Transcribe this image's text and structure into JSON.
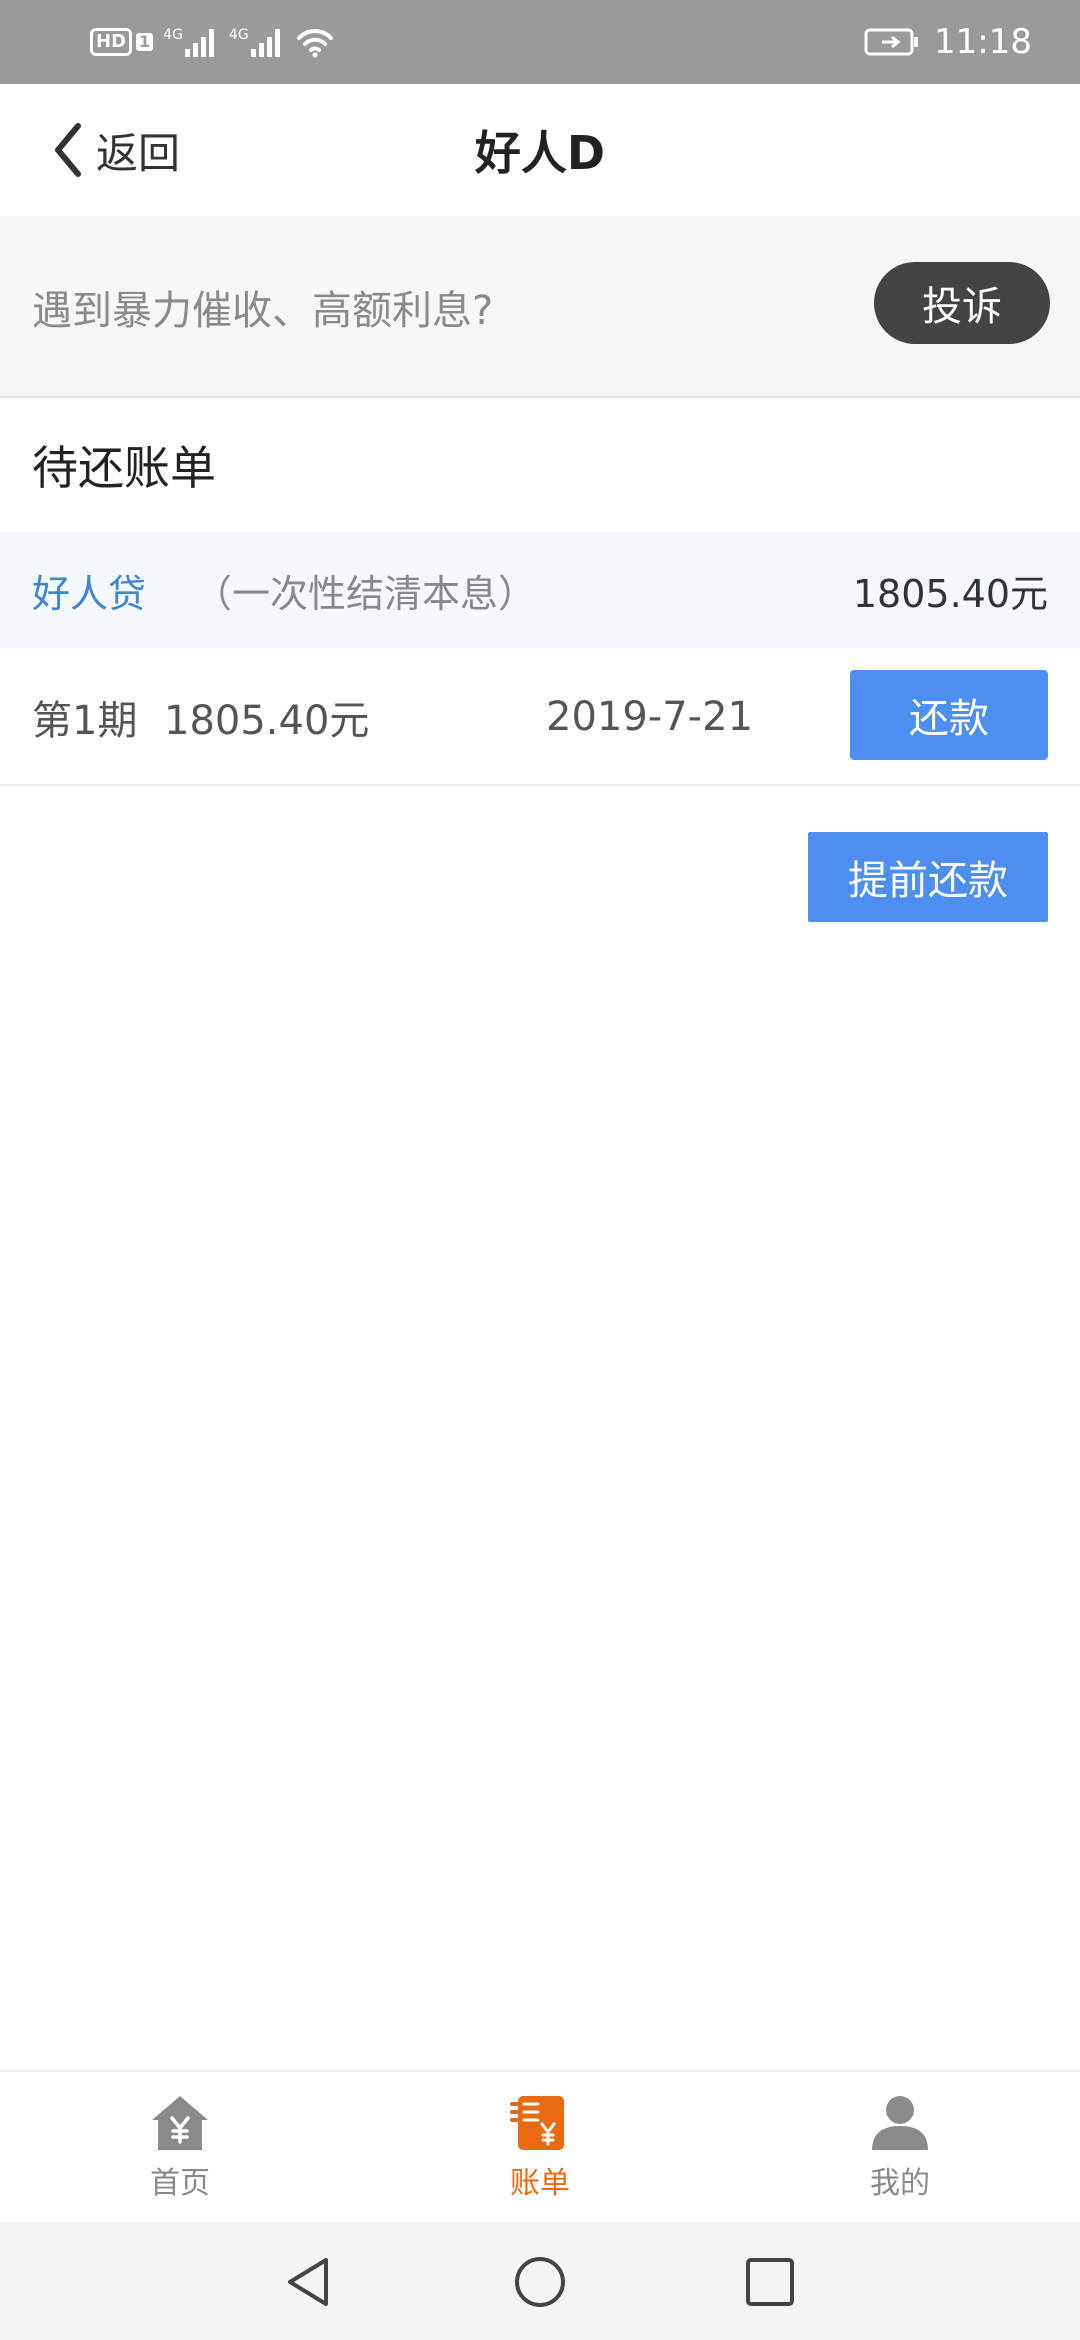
{
  "status_bar": {
    "hd_label": "HD",
    "sim_number": "1",
    "network_1": "4G",
    "network_2": "4G",
    "time": "11:18",
    "icons": [
      "hd-icon",
      "signal-icon",
      "signal-icon",
      "wifi-icon",
      "battery-icon"
    ]
  },
  "header": {
    "back_label": "返回",
    "title": "好人D"
  },
  "complaint": {
    "text": "遇到暴力催收、高额利息?",
    "button_label": "投诉"
  },
  "bills": {
    "section_title": "待还账单",
    "loan": {
      "name": "好人贷",
      "type": "（一次性结清本息）",
      "total": "1805.40元"
    },
    "installments": [
      {
        "period": "第1期",
        "amount": "1805.40元",
        "date": "2019-7-21",
        "repay_label": "还款"
      }
    ],
    "prepay_label": "提前还款"
  },
  "tabs": [
    {
      "label": "首页",
      "icon": "home-yen-icon",
      "active": false
    },
    {
      "label": "账单",
      "icon": "bill-icon",
      "active": true
    },
    {
      "label": "我的",
      "icon": "user-icon",
      "active": false
    }
  ],
  "colors": {
    "accent_blue": "#4d8ff0",
    "link_blue": "#3f86d4",
    "active_tab": "#e86a12",
    "complaint_button": "#444444"
  }
}
